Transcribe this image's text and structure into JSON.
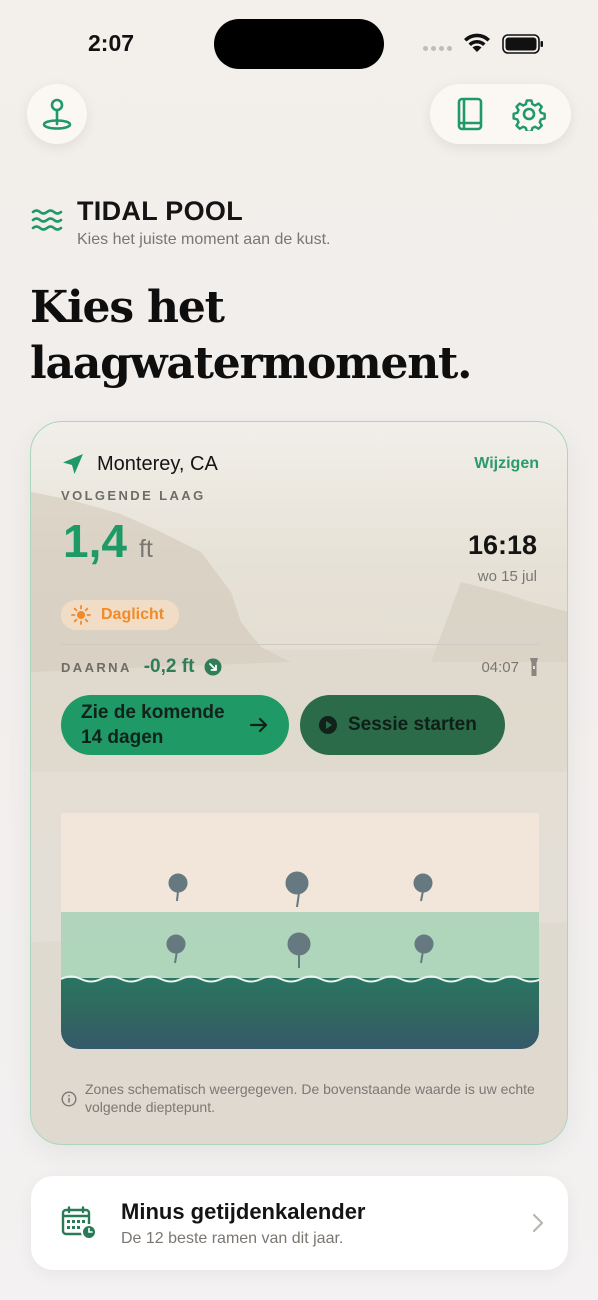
{
  "status_bar": {
    "time": "2:07"
  },
  "header": {
    "brand_title": "TIDAL POOL",
    "brand_subtitle": "Kies het juiste moment aan de kust.",
    "headline": "Kies het laagwatermoment."
  },
  "card": {
    "location": "Monterey, CA",
    "change_label": "Wijzigen",
    "next_label": "VOLGENDE LAAG",
    "depth_value": "1,4",
    "depth_unit": "ft",
    "tide_time": "16:18",
    "tide_date": "wo 15 jul",
    "daylight_label": "Daglicht",
    "then_label": "DAARNA",
    "then_value": "-0,2 ft",
    "then_time": "04:07",
    "primary_button": "Zie de komende 14 dagen",
    "secondary_button": "Sessie starten",
    "note": "Zones schematisch weergegeven. De bovenstaande waarde is uw echte volgende dieptepunt."
  },
  "calendar_card": {
    "title": "Minus getijdenkalender",
    "subtitle": "De 12 beste ramen van dit jaar."
  },
  "colors": {
    "accent": "#1f9966",
    "accent_dark": "#2b6b49",
    "daylight": "#f08a2a"
  },
  "icons": [
    "map-pin-icon",
    "book-icon",
    "gear-icon",
    "waves-icon",
    "location-arrow-icon",
    "sun-icon",
    "arrow-down-right-icon",
    "flashlight-icon",
    "arrow-right-icon",
    "play-icon",
    "info-icon",
    "calendar-icon",
    "chevron-right-icon"
  ]
}
